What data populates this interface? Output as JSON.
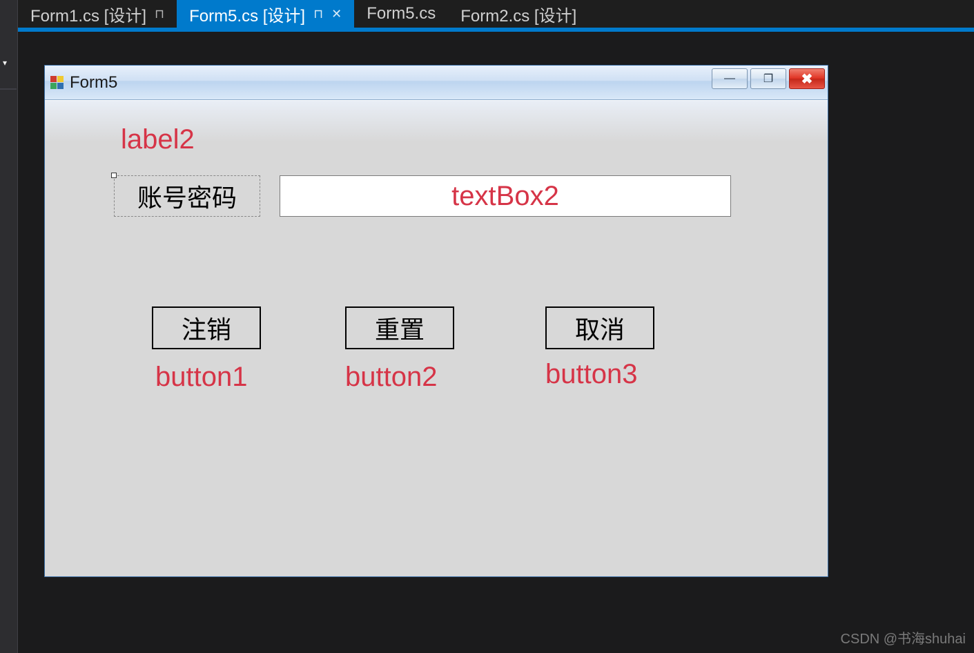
{
  "tabs": [
    {
      "label": "Form1.cs [设计]",
      "pinned": true,
      "active": false,
      "closable": false
    },
    {
      "label": "Form5.cs [设计]",
      "pinned": true,
      "active": true,
      "closable": true
    },
    {
      "label": "Form5.cs",
      "pinned": false,
      "active": false,
      "closable": false
    },
    {
      "label": "Form2.cs [设计]",
      "pinned": false,
      "active": false,
      "closable": false
    }
  ],
  "form": {
    "title": "Form5",
    "label2_text": "账号密码",
    "textbox2_value": "",
    "buttons": {
      "button1": "注销",
      "button2": "重置",
      "button3": "取消"
    }
  },
  "annotations": {
    "label2": "label2",
    "textbox2": "textBox2",
    "button1": "button1",
    "button2": "button2",
    "button3": "button3"
  },
  "watermark": "CSDN @书海shuhai",
  "glyphs": {
    "pin": "⊓",
    "close": "✕",
    "dropdown": "▾",
    "minimize": "—",
    "maximize": "❐",
    "winclose": "✖"
  }
}
